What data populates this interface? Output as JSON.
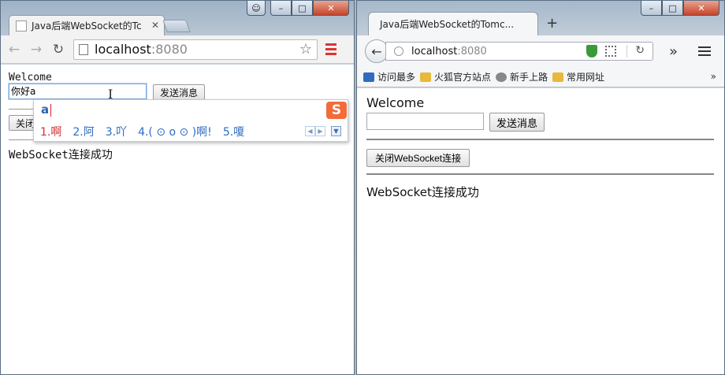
{
  "left_window": {
    "tab_title": "Java后端WebSocket的Tc",
    "url_host": "localhost",
    "url_port": ":8080",
    "page": {
      "welcome": "Welcome",
      "input_value": "你好a",
      "send_label": "发送消息",
      "close_label": "关闭",
      "status": "WebSocket连接成功"
    },
    "ime": {
      "composition": "a",
      "candidates": [
        "1.啊",
        "2.阿",
        "3.吖",
        "4.( ⊙ o ⊙ )啊!",
        "5.嗄"
      ],
      "logo": "S"
    }
  },
  "right_window": {
    "tab_title": "Java后端WebSocket的Tomc...",
    "url_host": "localhost",
    "url_port": ":8080",
    "bookmarks": [
      "访问最多",
      "火狐官方站点",
      "新手上路",
      "常用网址"
    ],
    "page": {
      "welcome": "Welcome",
      "input_value": "",
      "send_label": "发送消息",
      "close_label": "关闭WebSocket连接",
      "status": "WebSocket连接成功"
    }
  },
  "colors": {
    "ime_candidate": "#2f6cc0",
    "ime_first": "#d23131",
    "close_button": "#c7432b"
  }
}
